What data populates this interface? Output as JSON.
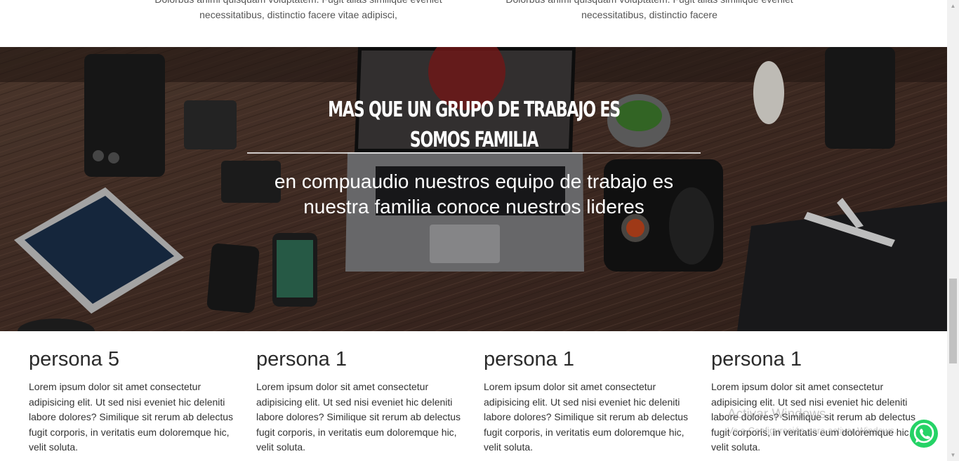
{
  "top_cards": [
    {
      "line1": "Dolorbus animi quisquam voluptatem. Fugit alias similique eveniet",
      "line2": "necessitatibus, distinctio facere vitae adipisci,"
    },
    {
      "line1": "Dolorbus animi quisquam voluptatem. Fugit alias similique eveniet",
      "line2": "necessitatibus, distinctio facere"
    }
  ],
  "hero": {
    "title": "MAS QUE UN GRUPO DE TRABAJO ES SOMOS FAMILIA",
    "subtitle": "en compuaudio nuestros equipo de trabajo es nuestra familia conoce nuestros lideres"
  },
  "persons": [
    {
      "name": "persona 5",
      "text": "Lorem ipsum dolor sit amet consectetur adipisicing elit. Ut sed nisi eveniet hic deleniti labore dolores? Similique sit rerum ab delectus fugit corporis, in veritatis eum doloremque hic, velit soluta."
    },
    {
      "name": "persona 1",
      "text": "Lorem ipsum dolor sit amet consectetur adipisicing elit. Ut sed nisi eveniet hic deleniti labore dolores? Similique sit rerum ab delectus fugit corporis, in veritatis eum doloremque hic, velit soluta."
    },
    {
      "name": "persona 1",
      "text": "Lorem ipsum dolor sit amet consectetur adipisicing elit. Ut sed nisi eveniet hic deleniti labore dolores? Similique sit rerum ab delectus fugit corporis, in veritatis eum doloremque hic, velit soluta."
    },
    {
      "name": "persona 1",
      "text": "Lorem ipsum dolor sit amet consectetur adipisicing elit. Ut sed nisi eveniet hic deleniti labore dolores? Similique sit rerum ab delectus fugit corporis, in veritatis eum doloremque hic, velit soluta."
    }
  ],
  "watermark": {
    "line1": "Activar Windows",
    "line2": "Ve a Configuración para activar Windows."
  },
  "icons": {
    "whatsapp": "whatsapp-icon"
  },
  "colors": {
    "whatsapp_green": "#25D366"
  }
}
